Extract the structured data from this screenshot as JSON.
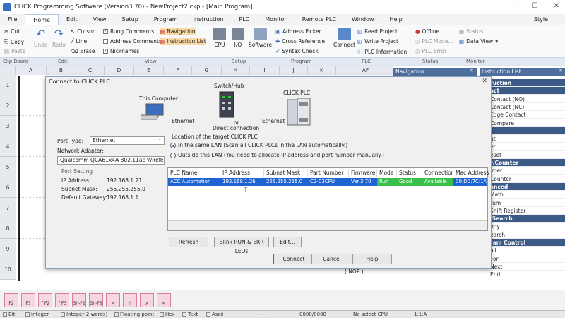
{
  "window": {
    "title": "CLICK Programming Software (Version3.70) - NewProject2.ckp - [Main Program]",
    "min": "—",
    "max": "☐",
    "close": "✕"
  },
  "menu": {
    "items": [
      "File",
      "Home",
      "Edit",
      "View",
      "Setup",
      "Program",
      "Instruction",
      "PLC",
      "Monitor",
      "Remote PLC",
      "Window",
      "Help"
    ],
    "active": "Home",
    "style": "Style"
  },
  "ribbon": {
    "clipboard": {
      "cut": "Cut",
      "copy": "Copy",
      "paste": "Paste"
    },
    "edit": {
      "undo": "Undo",
      "redo": "Redo",
      "cursor": "Cursor",
      "line": "Line",
      "erase": "Erase"
    },
    "view": {
      "rung_comments": "Rung Comments",
      "address_comments": "Address Comments",
      "nicknames": "Nicknames",
      "navigation": "Navigation",
      "instruction_list": "Instruction List"
    },
    "setup": {
      "cpu": "CPU",
      "io": "I/O",
      "software": "Software"
    },
    "program": {
      "address_picker": "Address Picker",
      "cross_reference": "Cross Reference",
      "syntax_check": "Syntax Check"
    },
    "plc": {
      "connect": "Connect",
      "read_project": "Read Project",
      "write_project": "Write Project",
      "plc_information": "PLC Information"
    },
    "status": {
      "offline": "Offline",
      "plc_mode": "PLC Mode...",
      "plc_error": "PLC Error"
    },
    "monitor": {
      "status": "Status",
      "data_view": "Data View"
    },
    "groups": [
      "Clip Board",
      "Edit",
      "View",
      "Setup",
      "Program",
      "PLC",
      "Status",
      "Monitor"
    ]
  },
  "grid": {
    "columns": [
      "A",
      "B",
      "C",
      "D",
      "E",
      "F",
      "G",
      "H",
      "I",
      "J",
      "K",
      "AF"
    ],
    "rows": [
      "1",
      "2",
      "3",
      "4",
      "5",
      "6",
      "7",
      "8",
      "9",
      "10"
    ],
    "nop": "( NOP )"
  },
  "panes": {
    "navigation": "Navigation",
    "instruction_list": "Instruction List",
    "instructions": [
      {
        "label": "ruction",
        "cat": true
      },
      {
        "label": "act",
        "cat": true
      },
      {
        "label": "Contact (NO)",
        "cat": false
      },
      {
        "label": "Contact (NC)",
        "cat": false
      },
      {
        "label": "Edge Contact",
        "cat": false
      },
      {
        "label": "Compare",
        "cat": false
      },
      {
        "label": "",
        "cat": true
      },
      {
        "label": "ut",
        "cat": false
      },
      {
        "label": "et",
        "cat": false
      },
      {
        "label": "eset",
        "cat": false
      },
      {
        "label": "r/Counter",
        "cat": true
      },
      {
        "label": "imer",
        "cat": false
      },
      {
        "label": "Counter",
        "cat": false
      },
      {
        "label": "anced",
        "cat": true
      },
      {
        "label": "Math",
        "cat": false
      },
      {
        "label": "rum",
        "cat": false
      },
      {
        "label": "Shift Register",
        "cat": false
      },
      {
        "label": "/Search",
        "cat": true
      },
      {
        "label": "opy",
        "cat": false
      },
      {
        "label": "earch",
        "cat": false
      },
      {
        "label": "ram Control",
        "cat": true
      },
      {
        "label": "all",
        "cat": false
      },
      {
        "label": "For",
        "cat": false
      },
      {
        "label": "Next",
        "cat": false
      },
      {
        "label": "End",
        "cat": false
      }
    ]
  },
  "dialog": {
    "title": "Connect to CLICK PLC",
    "close": "✕",
    "diagram": {
      "computer": "This Computer",
      "switch": "Switch/Hub",
      "plc": "CLICK PLC",
      "ethernet1": "Ethernet",
      "or": "or",
      "direct": "Direct connection",
      "ethernet2": "Ethernet"
    },
    "location_label": "Location of the target CLICK PLC",
    "option_same_lan": "In the same LAN (Scan all CLICK PLCs in the LAN automatically.)",
    "option_outside_lan": "Outside this LAN (You need to allocate IP address and port number manually.)",
    "port_type_label": "Port Type:",
    "port_type_value": "Ethernet",
    "network_adapter_label": "Network Adapter:",
    "network_adapter_value": "Qualcomm QCA61x4A 802.11ac Wireless Ac",
    "port_setting_title": "Port Setting",
    "ip_label": "IP Address:",
    "ip_value": "192.168.1.21",
    "mask_label": "Subnet Mask:",
    "mask_value": "255.255.255.0",
    "gw_label": "Default Gateway:",
    "gw_value": "192.168.1.1",
    "table_headers": [
      "PLC Name",
      "IP Address",
      "Subnet Mask",
      "Part Number",
      "Firmware",
      "Mode",
      "Status",
      "Connection",
      "Mac Address"
    ],
    "table_row": [
      "ACC Automation",
      "192.168.1.26",
      "255.255.255.0",
      "C2-03CPU",
      "Ver.3.70",
      "Run",
      "Good",
      "Available",
      "00:D0:7C:1A:4"
    ],
    "btn_refresh": "Refresh",
    "btn_blink": "Blink RUN & ERR LEDs",
    "btn_edit": "Edit...",
    "btn_connect": "Connect",
    "btn_cancel": "Cancel",
    "btn_help": "Help"
  },
  "instruction_buttons": [
    "F2",
    "F3",
    "^F2",
    "^F3",
    "Sh-F2",
    "Sh-F3",
    "=",
    "!",
    ">",
    "<"
  ],
  "status_bar": {
    "bit": "Bit",
    "integer": "Integer",
    "integer2": "Integer(2 words)",
    "float": "Floating point",
    "hex": "Hex",
    "text": "Text",
    "ascii": "Ascii",
    "dash": "----",
    "count": "0000/8000",
    "cpu": "No select CPU",
    "zoom": "1:1:A"
  },
  "colors": {
    "row_highlight": "#1e64d2",
    "mode_run": "#39c04b",
    "accent": "#3c5a86"
  }
}
